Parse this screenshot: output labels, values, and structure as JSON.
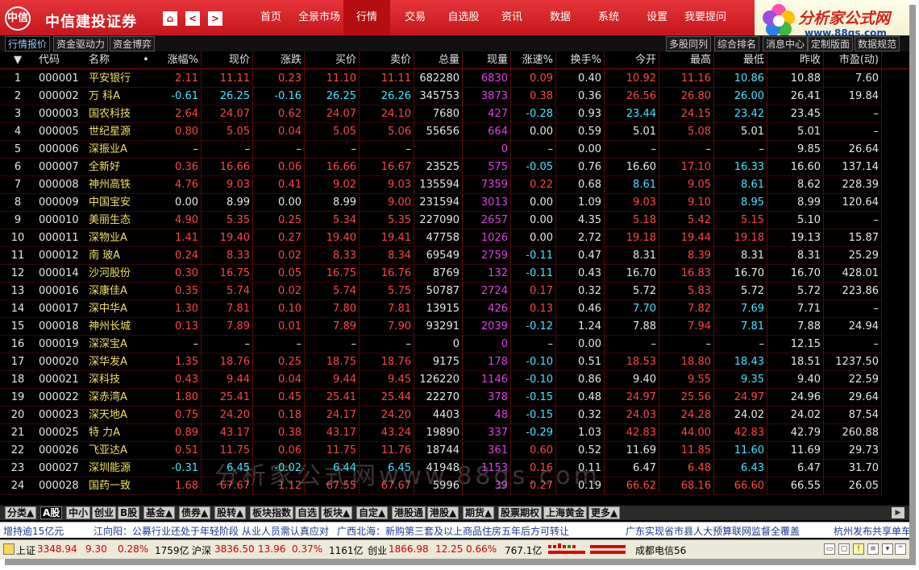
{
  "title": {
    "logo": "中信",
    "brand": "中信建投证券",
    "home": "⌂",
    "back": "<",
    "forward": ">"
  },
  "menu": [
    {
      "label": "首页",
      "active": false
    },
    {
      "label": "全景市场",
      "active": false
    },
    {
      "label": "行情",
      "active": true
    },
    {
      "label": "交易",
      "active": false
    },
    {
      "label": "自选股",
      "active": false
    },
    {
      "label": "资讯",
      "active": false
    },
    {
      "label": "数据",
      "active": false
    },
    {
      "label": "系统",
      "active": false
    },
    {
      "label": "设置",
      "active": false
    },
    {
      "label": "我要提问",
      "active": false
    }
  ],
  "ad": {
    "title": "分析家公式网",
    "url": "www.88gs.com"
  },
  "subtabs_left": [
    {
      "label": "行情报价",
      "active": true
    },
    {
      "label": "资金驱动力",
      "active": false
    },
    {
      "label": "资金博弈",
      "active": false
    }
  ],
  "subtabs_right": [
    {
      "label": "多股同列"
    },
    {
      "label": "综合排名"
    },
    {
      "label": "消息中心"
    },
    {
      "label": "定制版面"
    },
    {
      "label": "数据规范"
    }
  ],
  "columns": [
    {
      "label": "▼"
    },
    {
      "label": "代码"
    },
    {
      "label": "名称"
    },
    {
      "label": "•"
    },
    {
      "label": "涨幅%"
    },
    {
      "label": "现价"
    },
    {
      "label": "涨跌"
    },
    {
      "label": "买价"
    },
    {
      "label": "卖价"
    },
    {
      "label": "总量"
    },
    {
      "label": "现量"
    },
    {
      "label": "涨速%"
    },
    {
      "label": "换手%"
    },
    {
      "label": "今开"
    },
    {
      "label": "最高"
    },
    {
      "label": "最低"
    },
    {
      "label": "昨收"
    },
    {
      "label": "市盈(动)"
    }
  ],
  "rows": [
    [
      "1",
      "000001",
      "平安银行",
      "2.11",
      "11.11",
      "0.23",
      "11.10",
      "11.11",
      "682280",
      "6830",
      "0.09",
      "0.40",
      "10.92",
      "11.16",
      "10.86",
      "10.88",
      "7.60"
    ],
    [
      "2",
      "000002",
      "万 科A",
      "-0.61",
      "26.25",
      "-0.16",
      "26.25",
      "26.26",
      "345753",
      "3873",
      "0.38",
      "0.36",
      "26.56",
      "26.80",
      "26.00",
      "26.41",
      "19.84"
    ],
    [
      "3",
      "000003",
      "国农科技",
      "2.64",
      "24.07",
      "0.62",
      "24.07",
      "24.10",
      "7680",
      "427",
      "-0.28",
      "0.93",
      "23.44",
      "24.15",
      "23.42",
      "23.45",
      "–"
    ],
    [
      "4",
      "000005",
      "世纪星源",
      "0.80",
      "5.05",
      "0.04",
      "5.05",
      "5.06",
      "55656",
      "664",
      "0.00",
      "0.59",
      "5.01",
      "5.08",
      "5.01",
      "5.01",
      "–"
    ],
    [
      "5",
      "000006",
      "深振业A",
      "–",
      "–",
      "–",
      "–",
      "–",
      "",
      "0",
      "–",
      "0.00",
      "–",
      "–",
      "–",
      "9.85",
      "26.64"
    ],
    [
      "6",
      "000007",
      "全新好",
      "0.36",
      "16.66",
      "0.06",
      "16.66",
      "16.67",
      "23525",
      "575",
      "-0.05",
      "0.76",
      "16.60",
      "17.10",
      "16.33",
      "16.60",
      "137.14"
    ],
    [
      "7",
      "000008",
      "神州高铁",
      "4.76",
      "9.03",
      "0.41",
      "9.02",
      "9.03",
      "135594",
      "7359",
      "0.22",
      "0.68",
      "8.61",
      "9.05",
      "8.61",
      "8.62",
      "228.39"
    ],
    [
      "8",
      "000009",
      "中国宝安",
      "0.00",
      "8.99",
      "0.00",
      "8.99",
      "9.00",
      "231594",
      "3013",
      "0.00",
      "1.09",
      "9.03",
      "9.10",
      "8.95",
      "8.99",
      "120.64"
    ],
    [
      "9",
      "000010",
      "美丽生态",
      "4.90",
      "5.35",
      "0.25",
      "5.34",
      "5.35",
      "227090",
      "2657",
      "0.00",
      "4.35",
      "5.18",
      "5.42",
      "5.15",
      "5.10",
      "–"
    ],
    [
      "10",
      "000011",
      "深物业A",
      "1.41",
      "19.40",
      "0.27",
      "19.40",
      "19.41",
      "47758",
      "1026",
      "0.00",
      "2.72",
      "19.18",
      "19.44",
      "19.18",
      "19.13",
      "15.87"
    ],
    [
      "11",
      "000012",
      "南 玻A",
      "0.24",
      "8.33",
      "0.02",
      "8.33",
      "8.34",
      "69549",
      "2759",
      "-0.11",
      "0.47",
      "8.31",
      "8.39",
      "8.31",
      "8.31",
      "25.29"
    ],
    [
      "12",
      "000014",
      "沙河股份",
      "0.30",
      "16.75",
      "0.05",
      "16.75",
      "16.76",
      "8769",
      "132",
      "-0.11",
      "0.43",
      "16.70",
      "16.83",
      "16.70",
      "16.70",
      "428.01"
    ],
    [
      "13",
      "000016",
      "深康佳A",
      "0.35",
      "5.74",
      "0.02",
      "5.74",
      "5.75",
      "50787",
      "2724",
      "0.17",
      "0.32",
      "5.72",
      "5.83",
      "5.72",
      "5.72",
      "223.86"
    ],
    [
      "14",
      "000017",
      "深中华A",
      "1.30",
      "7.81",
      "0.10",
      "7.80",
      "7.81",
      "13915",
      "426",
      "0.13",
      "0.46",
      "7.70",
      "7.82",
      "7.69",
      "7.71",
      "–"
    ],
    [
      "15",
      "000018",
      "神州长城",
      "0.13",
      "7.89",
      "0.01",
      "7.89",
      "7.90",
      "93291",
      "2039",
      "-0.12",
      "1.24",
      "7.88",
      "7.94",
      "7.81",
      "7.88",
      "24.94"
    ],
    [
      "16",
      "000019",
      "深深宝A",
      "–",
      "–",
      "–",
      "–",
      "–",
      "0",
      "0",
      "–",
      "0.00",
      "–",
      "–",
      "–",
      "12.15",
      "–"
    ],
    [
      "17",
      "000020",
      "深华发A",
      "1.35",
      "18.76",
      "0.25",
      "18.75",
      "18.76",
      "9175",
      "178",
      "-0.10",
      "0.51",
      "18.53",
      "18.80",
      "18.43",
      "18.51",
      "1237.50"
    ],
    [
      "18",
      "000021",
      "深科技",
      "0.43",
      "9.44",
      "0.04",
      "9.44",
      "9.45",
      "126220",
      "1146",
      "-0.10",
      "0.86",
      "9.40",
      "9.55",
      "9.35",
      "9.40",
      "22.59"
    ],
    [
      "19",
      "000022",
      "深赤湾A",
      "1.80",
      "25.41",
      "0.45",
      "25.41",
      "25.44",
      "22270",
      "378",
      "-0.15",
      "0.48",
      "24.97",
      "25.56",
      "24.97",
      "24.96",
      "29.64"
    ],
    [
      "20",
      "000023",
      "深天地A",
      "0.75",
      "24.20",
      "0.18",
      "24.17",
      "24.20",
      "4403",
      "48",
      "-0.15",
      "0.32",
      "24.03",
      "24.28",
      "24.02",
      "24.02",
      "87.54"
    ],
    [
      "21",
      "000025",
      "特 力A",
      "0.89",
      "43.17",
      "0.38",
      "43.17",
      "43.24",
      "19890",
      "337",
      "-0.29",
      "1.03",
      "42.83",
      "44.00",
      "42.83",
      "42.79",
      "260.88"
    ],
    [
      "22",
      "000026",
      "飞亚达A",
      "0.51",
      "11.75",
      "0.06",
      "11.75",
      "11.76",
      "18744",
      "361",
      "0.60",
      "0.52",
      "11.69",
      "11.85",
      "11.60",
      "11.69",
      "29.73"
    ],
    [
      "23",
      "000027",
      "深圳能源",
      "-0.31",
      "6.45",
      "-0.02",
      "6.44",
      "6.45",
      "41948",
      "1153",
      "0.16",
      "0.11",
      "6.47",
      "6.48",
      "6.43",
      "6.47",
      "31.70"
    ],
    [
      "24",
      "000028",
      "国药一致",
      "1.68",
      "67.67",
      "1.12",
      "67.55",
      "67.67",
      "5996",
      "39",
      "0.27",
      "0.19",
      "66.62",
      "68.16",
      "66.60",
      "66.55",
      "26.05"
    ]
  ],
  "bottom_tabs": [
    {
      "label": "分类▲",
      "active": false
    },
    {
      "label": "A股",
      "active": true
    },
    {
      "label": "中小",
      "active": false
    },
    {
      "label": "创业",
      "active": false
    },
    {
      "label": "B股",
      "active": false
    },
    {
      "label": "基金▲",
      "active": false
    },
    {
      "label": "债券▲",
      "active": false
    },
    {
      "label": "股转▲",
      "active": false
    },
    {
      "label": "板块指数",
      "active": false
    },
    {
      "label": "自选",
      "active": false
    },
    {
      "label": "板块▲",
      "active": false
    },
    {
      "label": "自定▲",
      "active": false
    },
    {
      "label": "港股通",
      "active": false
    },
    {
      "label": "港股▲",
      "active": false
    },
    {
      "label": "期货▲",
      "active": false
    },
    {
      "label": "股票期权",
      "active": false
    },
    {
      "label": "上海黄金",
      "active": false
    },
    {
      "label": "更多▲",
      "active": false
    }
  ],
  "news": [
    "增持逾15亿元",
    "江向阳：公募行业还处于年轻阶段 从业人员需认真应对",
    "广西北海：新购第三套及以上商品住房五年后方可转让",
    "广东实现省市县人大预算联网监督全覆盖",
    "杭州发布共享单车"
  ],
  "status": {
    "sh_label": "上证",
    "sh_value": "3348.94",
    "sh_change": "9.30",
    "sh_pct": "0.28%",
    "sh_amount": "1759亿",
    "sz_label": "沪深",
    "sz_value": "3836.50",
    "sz_change": "13.96",
    "sz_pct": "0.37%",
    "sz_amount": "1161亿",
    "cy_label": "创业",
    "cy_value": "1866.98",
    "cy_change": "12.25",
    "cy_pct": "0.66%",
    "cy_amount": "767.1亿",
    "server": "成都电信56"
  },
  "watermark": "分析家公式网www.88gs.com",
  "colors": {
    "up": "#ff4545",
    "down": "#40e6ff",
    "neutral": "#e6e6e6",
    "volume": "#e040e0",
    "title_bar": "#c5161c"
  }
}
